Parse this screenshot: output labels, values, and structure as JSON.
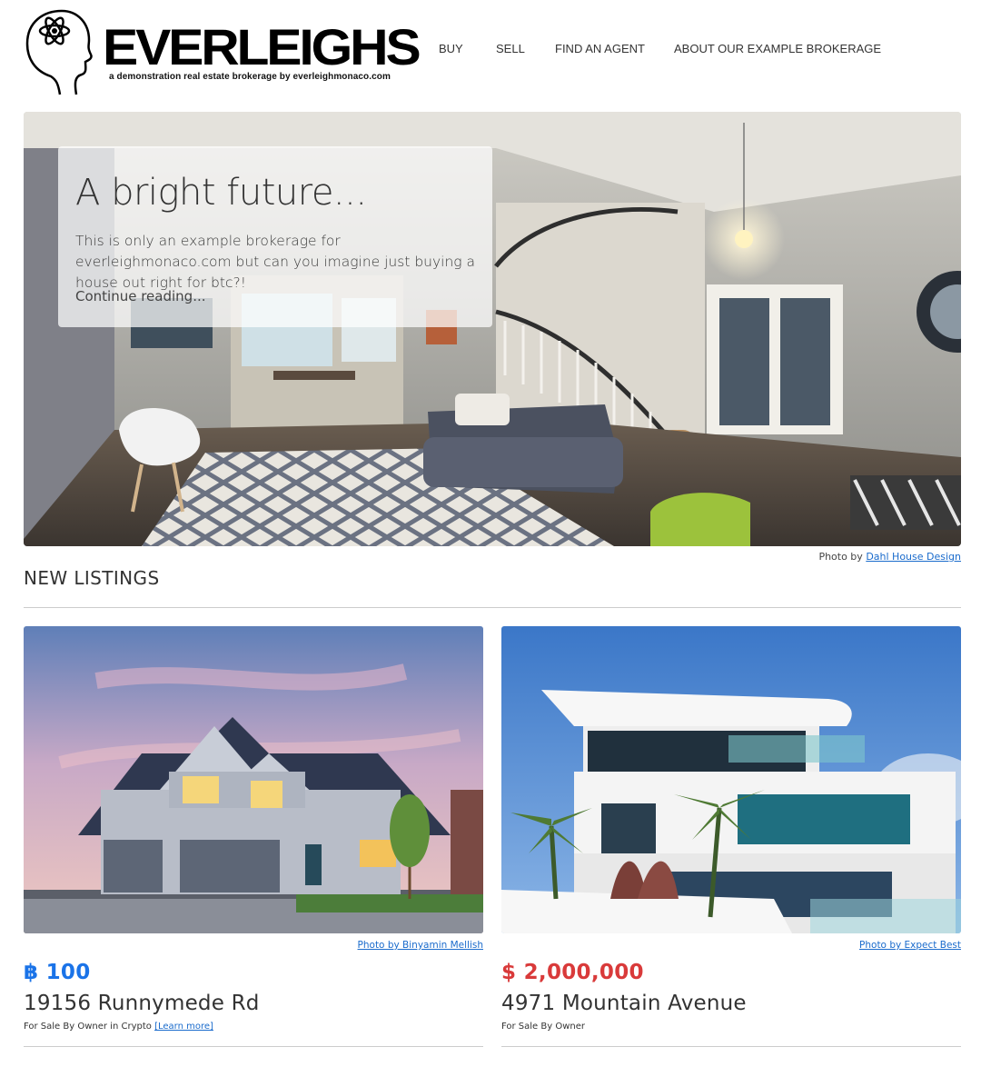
{
  "brand": {
    "name": "EVERLEIGHS",
    "tagline": "a demonstration real estate brokerage by everleighmonaco.com"
  },
  "nav": {
    "items": [
      {
        "label": "BUY"
      },
      {
        "label": "SELL"
      },
      {
        "label": "FIND AN AGENT"
      },
      {
        "label": "ABOUT OUR EXAMPLE BROKERAGE"
      }
    ]
  },
  "hero": {
    "title": "A bright future...",
    "text": "This is only an example brokerage for everleighmonaco.com but can you imagine just buying a house out right for btc?!",
    "link": "Continue reading...",
    "credit_prefix": "Photo by",
    "credit_name": "Dahl House Design"
  },
  "listings_section": {
    "title": "NEW LISTINGS"
  },
  "listings": [
    {
      "credit": "Photo by Binyamin Mellish",
      "price": "฿ 100",
      "price_color": "#1a73e8",
      "address": "19156 Runnymede Rd",
      "meta": "For Sale By Owner in Crypto",
      "meta_link": "[Learn more]"
    },
    {
      "credit": "Photo by Expect Best",
      "price": "$ 2,000,000",
      "price_color": "#d93a3a",
      "address": "4971 Mountain Avenue",
      "meta": "For Sale By Owner",
      "meta_link": ""
    }
  ],
  "colors": {
    "link": "#1a6bcc",
    "btc_price": "#1a73e8",
    "usd_price": "#d93a3a"
  }
}
